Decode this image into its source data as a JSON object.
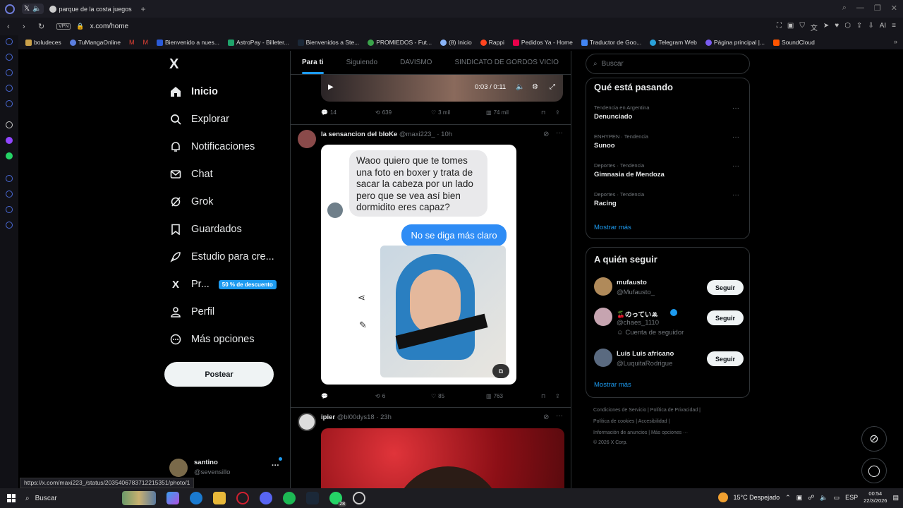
{
  "browser": {
    "tab_title": "parque de la costa juegos",
    "url": "x.com/home",
    "vpn": "VPN",
    "bookmarks": [
      "boludeces",
      "TuMangaOnline",
      "",
      "",
      "Bienvenido a nues...",
      "AstroPay - Billeter...",
      "Bienvenidos a Ste...",
      "PROMIEDOS - Fut...",
      "(8) Inicio",
      "Rappi",
      "Pedidos Ya - Home",
      "Traductor de Goo...",
      "Telegram Web",
      "Página principal |...",
      "SoundCloud"
    ],
    "status_url": "https://x.com/maxi223_/status/2035406783712215351/photo/1"
  },
  "nav": {
    "logo": "X",
    "items": [
      {
        "label": "Inicio",
        "icon": "home-icon"
      },
      {
        "label": "Explorar",
        "icon": "search-icon"
      },
      {
        "label": "Notificaciones",
        "icon": "bell-icon"
      },
      {
        "label": "Chat",
        "icon": "mail-icon"
      },
      {
        "label": "Grok",
        "icon": "grok-icon"
      },
      {
        "label": "Guardados",
        "icon": "bookmark-icon"
      },
      {
        "label": "Estudio para cre...",
        "icon": "rocket-icon"
      },
      {
        "label": "Pr...",
        "icon": "x-icon"
      },
      {
        "label": "Perfil",
        "icon": "person-icon"
      },
      {
        "label": "Más opciones",
        "icon": "more-circle-icon"
      }
    ],
    "promo_badge": "50 % de descuento",
    "post_button": "Postear",
    "user": {
      "name": "santino",
      "handle": "@sevensillo",
      "more": "···"
    }
  },
  "feed": {
    "tabs": [
      "Para ti",
      "Siguiendo",
      "DAVISMO",
      "SINDICATO DE GORDOS VICIO"
    ],
    "active_tab": 0,
    "video": {
      "time": "0:03 / 0:11"
    },
    "post0_stats": {
      "replies": "14",
      "reposts": "639",
      "likes": "3 mil",
      "views": "74 mil"
    },
    "post1": {
      "name": "la sensancion del bloKe",
      "handle": "@maxi223_",
      "time": "· 10h",
      "bubble_in": "Waoo quiero que te tomes una foto en boxer y trata de sacar la cabeza por un lado pero que se vea así bien dormidito eres capaz?",
      "bubble_out": "No se diga más claro",
      "stats": {
        "replies": "",
        "reposts": "6",
        "likes": "85",
        "views": "763"
      }
    },
    "post2": {
      "name": "ipier",
      "handle": "@bl00dys18",
      "time": "· 23h"
    }
  },
  "right": {
    "search_placeholder": "Buscar",
    "trends_title": "Qué está pasando",
    "trends": [
      {
        "meta": "Tendencia en Argentina",
        "name": "Denunciado"
      },
      {
        "meta": "ENHYPEN · Tendencia",
        "name": "Sunoo"
      },
      {
        "meta": "Deportes · Tendencia",
        "name": "Gimnasia de Mendoza"
      },
      {
        "meta": "Deportes · Tendencia",
        "name": "Racing"
      }
    ],
    "show_more": "Mostrar más",
    "who_title": "A quién seguir",
    "who": [
      {
        "name": "mufausto",
        "handle": "@Mufausto_",
        "extra": ""
      },
      {
        "name": "🍒のっていꔛ",
        "handle": "@chaes_1110",
        "extra": "Cuenta de seguidor"
      },
      {
        "name": "Luis Luis africano",
        "handle": "@LuquitaRodrigue",
        "extra": ""
      }
    ],
    "follow_label": "Seguir",
    "footer": [
      "Condiciones de Servicio  |  Política de Privacidad  |",
      "Política de cookies  |  Accesibilidad  |",
      "Información de anuncios  |  Más opciones ···",
      "© 2026 X Corp."
    ]
  },
  "taskbar": {
    "search": "Buscar",
    "weather": "15°C  Despejado",
    "lang": "ESP",
    "time": "00:54",
    "date": "22/3/2026",
    "whatsapp_badge": "28"
  },
  "colors": {
    "accent": "#1d9bf0",
    "bg": "#000000",
    "border": "#2f3336",
    "muted": "#71767b"
  }
}
